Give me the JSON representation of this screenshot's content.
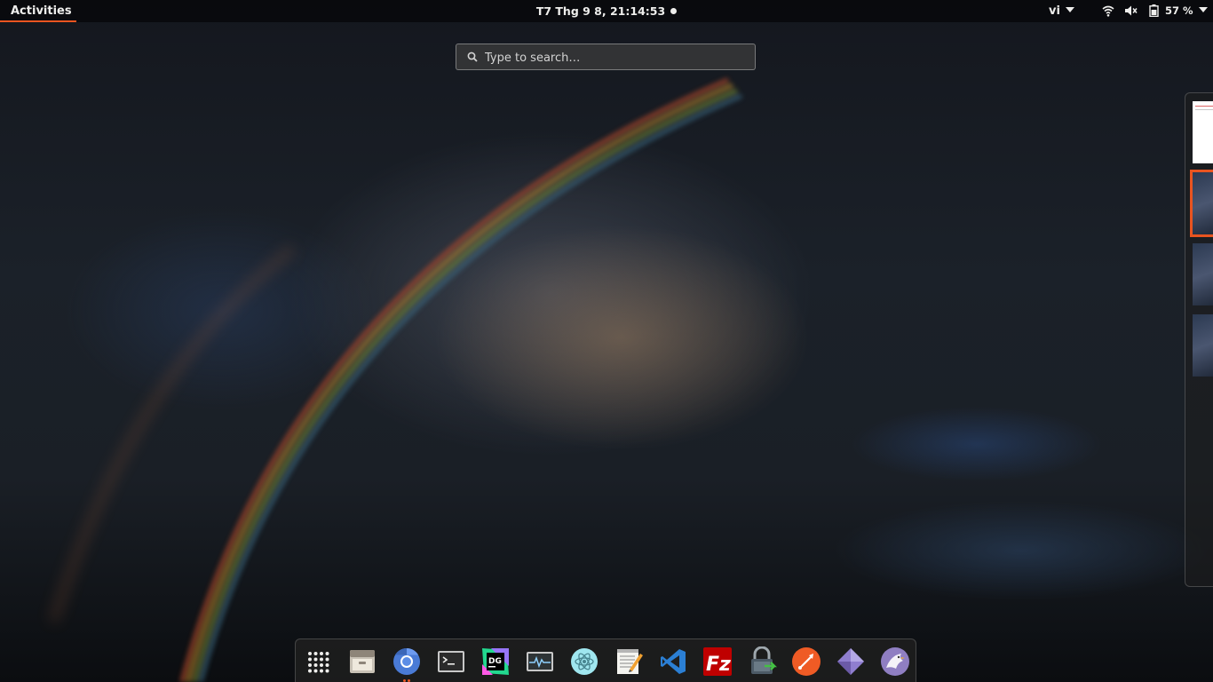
{
  "topbar": {
    "activities_label": "Activities",
    "clock": "T7 Thg 9  8, 21:14:53",
    "language": "vi",
    "battery_percent": "57 %",
    "accent_color": "#e95420"
  },
  "search": {
    "placeholder": "Type to search…"
  },
  "tray_icons": [
    "wifi-icon",
    "volume-muted-icon",
    "battery-icon",
    "system-menu-chevron-icon"
  ],
  "workspaces": [
    "workspace-1",
    "workspace-2-active",
    "workspace-3",
    "workspace-4"
  ],
  "dock": {
    "items": [
      "show-applications-icon",
      "files-icon",
      "chromium-icon",
      "terminal-icon",
      "datagrip-icon",
      "system-monitor-icon",
      "electron-app-icon",
      "text-editor-icon",
      "vscode-icon",
      "filezilla-icon",
      "password-safe-icon",
      "postman-icon",
      "emulator-icon",
      "eagle-app-icon"
    ],
    "running": [
      "chromium-icon"
    ]
  }
}
